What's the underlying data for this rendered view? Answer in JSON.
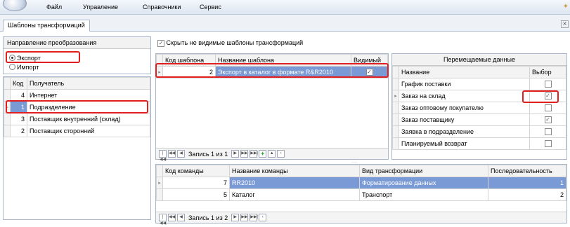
{
  "menu": {
    "items": [
      "Файл",
      "Управление",
      "Справочники",
      "Сервис"
    ]
  },
  "tab": {
    "label": "Шаблоны трансформаций",
    "close": "×"
  },
  "direction": {
    "header": "Направление преобразования",
    "options": [
      {
        "label": "Экспорт",
        "selected": true
      },
      {
        "label": "Импорт",
        "selected": false
      }
    ]
  },
  "recipients": {
    "columns": [
      "Код",
      "Получатель"
    ],
    "rows": [
      {
        "code": "4",
        "name": "Интернет"
      },
      {
        "code": "1",
        "name": "Подразделение"
      },
      {
        "code": "3",
        "name": "Поставщик внутренний (склад)"
      },
      {
        "code": "2",
        "name": "Поставщик сторонний"
      }
    ]
  },
  "templates": {
    "hide_label": "Скрыть не видимые шаблоны трансформаций",
    "columns": [
      "Код шаблона",
      "Название шаблона",
      "Видимый"
    ],
    "rows": [
      {
        "code": "2",
        "name": "Экспорт в каталог в формате R&R2010",
        "visible": true
      }
    ],
    "nav_text": "Запись 1 из 1"
  },
  "moved_data": {
    "header": "Перемещаемые данные",
    "columns": [
      "Название",
      "Выбор"
    ],
    "rows": [
      {
        "name": "График поставки",
        "checked": false
      },
      {
        "name": "Заказ на склад",
        "checked": true
      },
      {
        "name": "Заказ оптовому покупателю",
        "checked": false
      },
      {
        "name": "Заказ поставщику",
        "checked": true
      },
      {
        "name": "Заявка в подразделение",
        "checked": false
      },
      {
        "name": "Планируемый возврат",
        "checked": false
      }
    ]
  },
  "commands": {
    "columns": [
      "Код команды",
      "Название команды",
      "Вид трансформации",
      "Последовательность"
    ],
    "rows": [
      {
        "code": "7",
        "name": "RR2010",
        "type": "Форматирование данных",
        "seq": "1"
      },
      {
        "code": "5",
        "name": "Каталог",
        "type": "Транспорт",
        "seq": "2"
      }
    ],
    "nav_text": "Запись 1 из 2"
  }
}
